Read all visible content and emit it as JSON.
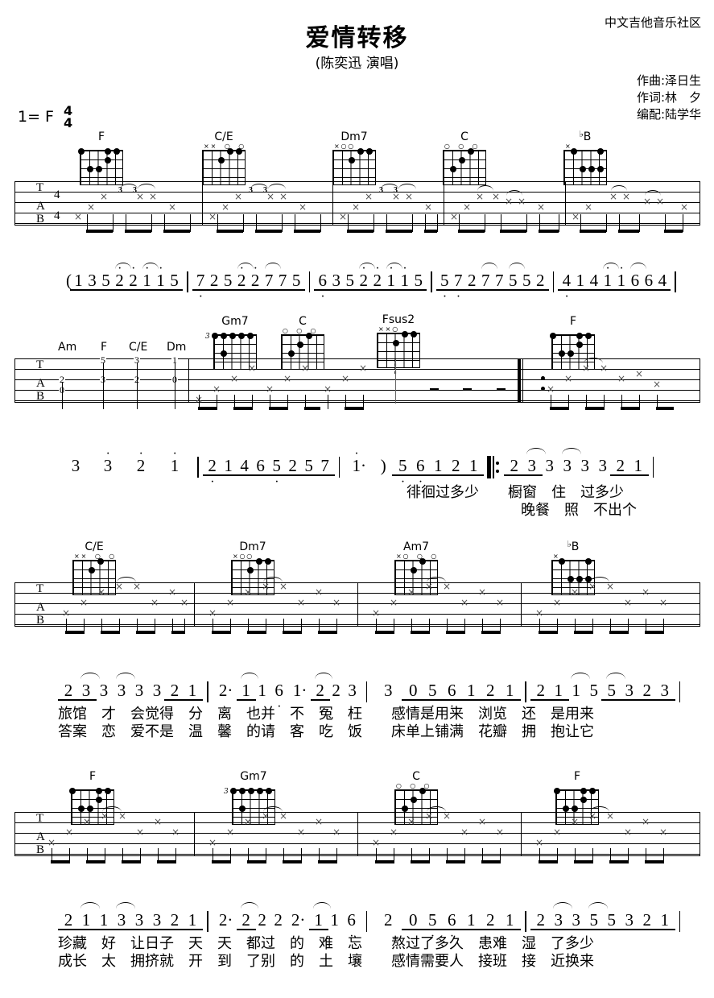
{
  "header": {
    "title": "爱情转移",
    "subtitle": "(陈奕迅 演唱)",
    "community": "中文吉他音乐社区",
    "credits": [
      "作曲:泽日生",
      "作词:林　夕",
      "编配:陆学华"
    ],
    "key_label": "1= F",
    "time_top": "4",
    "time_bottom": "4"
  },
  "tab_labels": {
    "t": "T",
    "a": "A",
    "b": "B"
  },
  "systems": [
    {
      "name": "system-1",
      "chords": [
        {
          "name": "F",
          "flat": false
        },
        {
          "name": "C/E",
          "flat": false
        },
        {
          "name": "Dm7",
          "flat": false
        },
        {
          "name": "C",
          "flat": false
        },
        {
          "name": "B",
          "flat": true
        }
      ],
      "triplet_marks": [
        "3",
        "3",
        "3",
        "3",
        "3",
        "3"
      ]
    },
    {
      "name": "system-2",
      "inline_chords": [
        "Am",
        "F",
        "C/E",
        "Dm"
      ],
      "chords": [
        {
          "name": "Gm7",
          "flat": false,
          "fret": "3"
        },
        {
          "name": "C",
          "flat": false
        },
        {
          "name": "Fsus2",
          "flat": false
        },
        {
          "name": "F",
          "flat": false
        }
      ]
    },
    {
      "name": "system-3",
      "chords": [
        {
          "name": "C/E",
          "flat": false
        },
        {
          "name": "Dm7",
          "flat": false
        },
        {
          "name": "Am7",
          "flat": false
        },
        {
          "name": "B",
          "flat": true
        }
      ]
    },
    {
      "name": "system-4",
      "chords": [
        {
          "name": "F",
          "flat": false
        },
        {
          "name": "Gm7",
          "flat": false,
          "fret": "3"
        },
        {
          "name": "C",
          "flat": false
        },
        {
          "name": "F",
          "flat": false
        }
      ]
    }
  ],
  "jianpu": {
    "row1": {
      "open_paren": "(",
      "measures": [
        {
          "notes": [
            "1",
            "3",
            "5",
            "2",
            "2",
            "1",
            "1",
            "5"
          ]
        },
        {
          "notes": [
            "7",
            "2",
            "5",
            "2",
            "2",
            "7",
            "7",
            "5"
          ]
        },
        {
          "notes": [
            "6",
            "3",
            "5",
            "2",
            "2",
            "1",
            "1",
            "5"
          ]
        },
        {
          "notes": [
            "5",
            "7",
            "2",
            "7",
            "7",
            "5",
            "5",
            "2"
          ]
        },
        {
          "notes": [
            "4",
            "1",
            "4",
            "1",
            "1",
            "6",
            "6",
            "4"
          ]
        }
      ]
    },
    "row2": {
      "measures": [
        {
          "notes": [
            "3",
            "3",
            "2",
            "1"
          ]
        },
        {
          "notes": [
            "2",
            "1",
            "4",
            "6",
            "5",
            "2",
            "5",
            "7"
          ]
        },
        {
          "notes": [
            "1·",
            ")",
            "5",
            "6",
            "1",
            "2",
            "1"
          ]
        },
        {
          "notes": [
            "2",
            "3",
            "3",
            "3",
            "3",
            "3",
            "2",
            "1"
          ]
        }
      ],
      "lyrics_line1": "徘徊过多少　　橱窗　住　过多少",
      "lyrics_line2": "晚餐　照　不出个",
      "lyric_groups": [
        {
          "text": "徘徊过多少",
          "row": 1
        },
        {
          "text": "橱窗　住　过多少",
          "row": 1
        },
        {
          "text": "晚餐　照　不出个",
          "row": 2
        }
      ]
    },
    "row3": {
      "measures": [
        {
          "notes": [
            "2",
            "3",
            "3",
            "3",
            "3",
            "3",
            "2",
            "1"
          ]
        },
        {
          "notes": [
            "2·",
            "1",
            "1",
            "6",
            "1·",
            "2",
            "2",
            "3"
          ]
        },
        {
          "notes": [
            "3",
            "0",
            "5",
            "6",
            "1",
            "2",
            "1"
          ]
        },
        {
          "notes": [
            "2",
            "1",
            "1",
            "5",
            "5",
            "3",
            "2",
            "3"
          ]
        }
      ],
      "lyrics_line1": "旅馆　才　会觉得　分　离　也并　不　冤　枉　　感情是用来　浏览　还　是用来",
      "lyrics_line2": "答案　恋　爱不是　温　馨　的请　客　吃　饭　　床单上铺满　花瓣　拥　抱让它"
    },
    "row4": {
      "measures": [
        {
          "notes": [
            "2",
            "1",
            "1",
            "3",
            "3",
            "3",
            "2",
            "1"
          ]
        },
        {
          "notes": [
            "2·",
            "2",
            "2",
            "2",
            "2·",
            "1",
            "1",
            "6"
          ]
        },
        {
          "notes": [
            "2",
            "0",
            "5",
            "6",
            "1",
            "2",
            "1"
          ]
        },
        {
          "notes": [
            "2",
            "3",
            "3",
            "5",
            "5",
            "3",
            "2",
            "1"
          ]
        }
      ],
      "lyrics_line1": "珍藏　好　让日子　天　天　都过　的　难　忘　　熬过了多久　患难　湿　了多少",
      "lyrics_line2": "成长　太　拥挤就　开　到　了别　的　土　壤　　感情需要人　接班　接　近换来"
    }
  },
  "colors": {
    "ink": "#000000",
    "paper": "#ffffff",
    "xmark": "#555555"
  }
}
